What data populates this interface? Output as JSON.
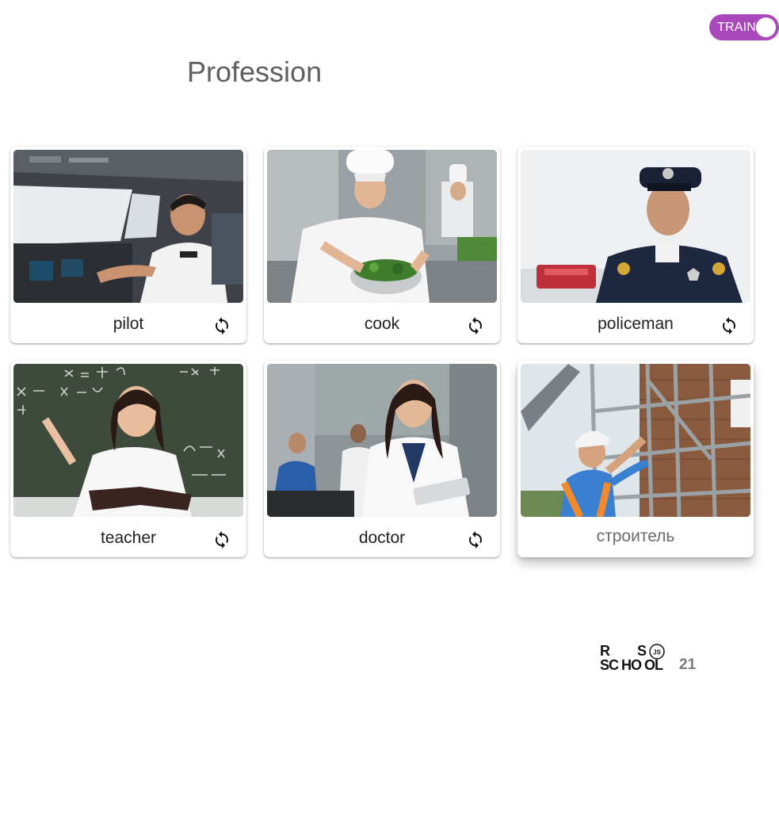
{
  "toggle": {
    "label": "TRAIN"
  },
  "page": {
    "title": "Profession"
  },
  "cards": [
    {
      "word": "pilot",
      "image": "pilot-photo"
    },
    {
      "word": "cook",
      "image": "cook-photo"
    },
    {
      "word": "policeman",
      "image": "policeman-photo"
    },
    {
      "word": "teacher",
      "image": "teacher-photo"
    },
    {
      "word": "doctor",
      "image": "doctor-photo"
    },
    {
      "word": "строитель",
      "image": "builder-photo",
      "flipped": true
    }
  ],
  "icons": {
    "rotate": "rotate-icon"
  },
  "footer": {
    "logo": {
      "line1": "R S",
      "line2": "SCHOOL",
      "badge": "JS",
      "number": "21"
    }
  },
  "colors": {
    "accent": "#ab47bc",
    "title": "#5f5f5f"
  }
}
